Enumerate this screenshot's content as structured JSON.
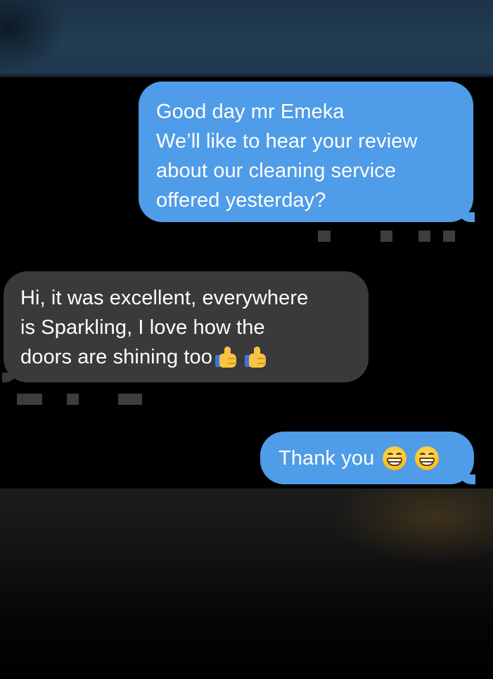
{
  "messages": [
    {
      "direction": "outgoing",
      "lines": [
        "Good day mr Emeka",
        "We’ll like to hear your review",
        "about our cleaning service",
        "offered yesterday?"
      ]
    },
    {
      "direction": "incoming",
      "lines": [
        "Hi, it was excellent, everywhere",
        "is Sparkling, I love how the",
        "doors are shining too"
      ],
      "emoji": [
        "thumbs-up",
        "thumbs-up"
      ]
    },
    {
      "direction": "outgoing",
      "text": "Thank you",
      "emoji": [
        "grinning-face",
        "grinning-face"
      ]
    }
  ],
  "colors": {
    "outgoing_bubble": "#4f9ce8",
    "incoming_bubble": "#3a3a3c",
    "background": "#000000",
    "text": "#ffffff"
  }
}
